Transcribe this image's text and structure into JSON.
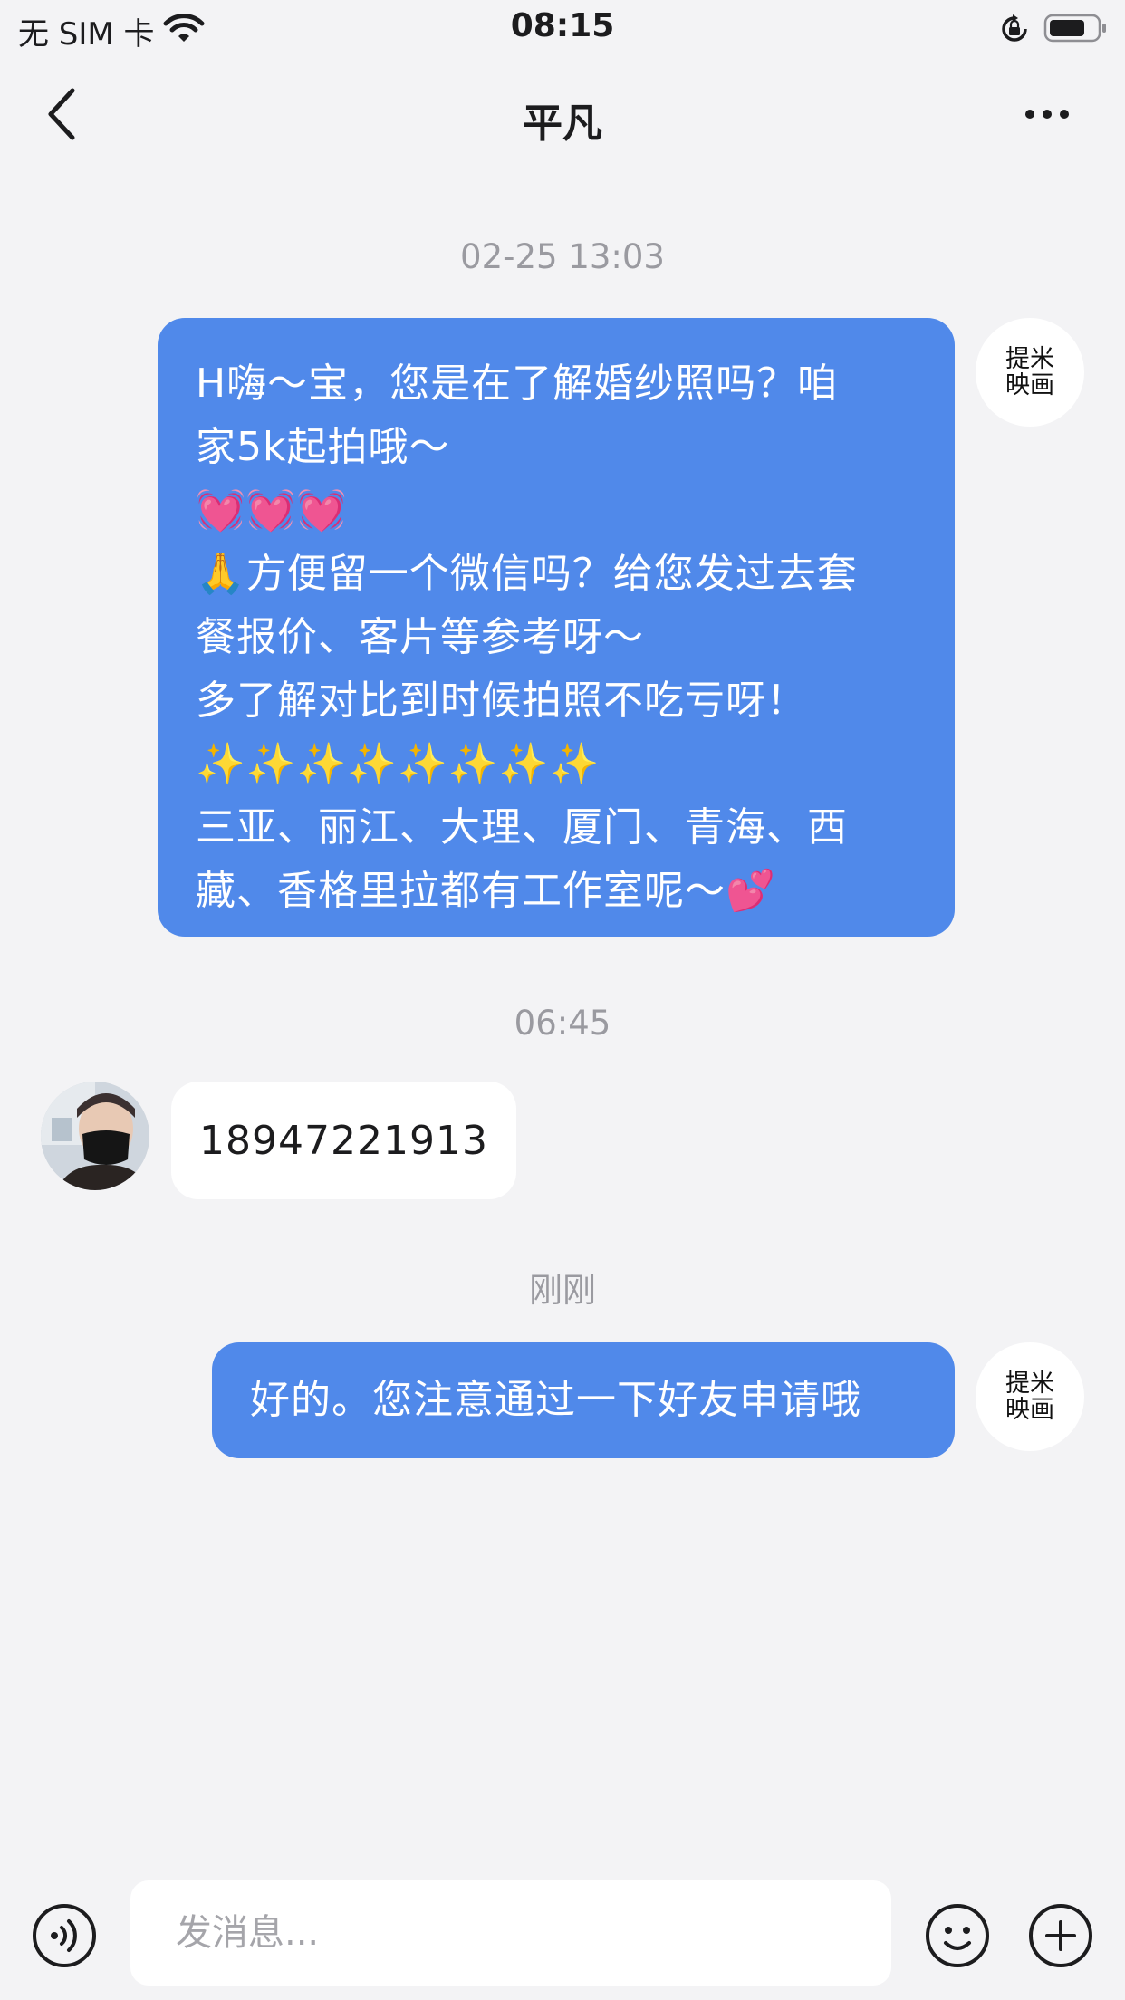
{
  "status_bar": {
    "carrier": "无 SIM 卡",
    "time": "08:15"
  },
  "nav": {
    "title": "平凡"
  },
  "brand_avatar": {
    "line1": "提米",
    "line2": "映画"
  },
  "messages": {
    "ts1": "02-25 13:03",
    "msg1": {
      "line1": "H嗨～宝，您是在了解婚纱照吗？咱",
      "line2": "家5k起拍哦～",
      "line3": "💓💓💓",
      "line4": "🙏方便留一个微信吗？给您发过去套",
      "line5": "餐报价、客片等参考呀～",
      "line6": "多了解对比到时候拍照不吃亏呀！",
      "line7": "✨✨✨✨✨✨✨✨",
      "line8": "三亚、丽江、大理、厦门、青海、西",
      "line9": "藏、香格里拉都有工作室呢～💕"
    },
    "ts2": "06:45",
    "msg2": "18947221913",
    "ts3": "刚刚",
    "msg3": "好的。您注意通过一下好友申请哦"
  },
  "input": {
    "placeholder": "发消息..."
  },
  "colors": {
    "accent_bubble": "#5089ea",
    "background": "#f3f3f5"
  },
  "icons": [
    "wifi-icon",
    "rotation-lock-icon",
    "battery-icon",
    "back-icon",
    "more-icon",
    "voice-icon",
    "emoji-icon",
    "plus-icon"
  ]
}
